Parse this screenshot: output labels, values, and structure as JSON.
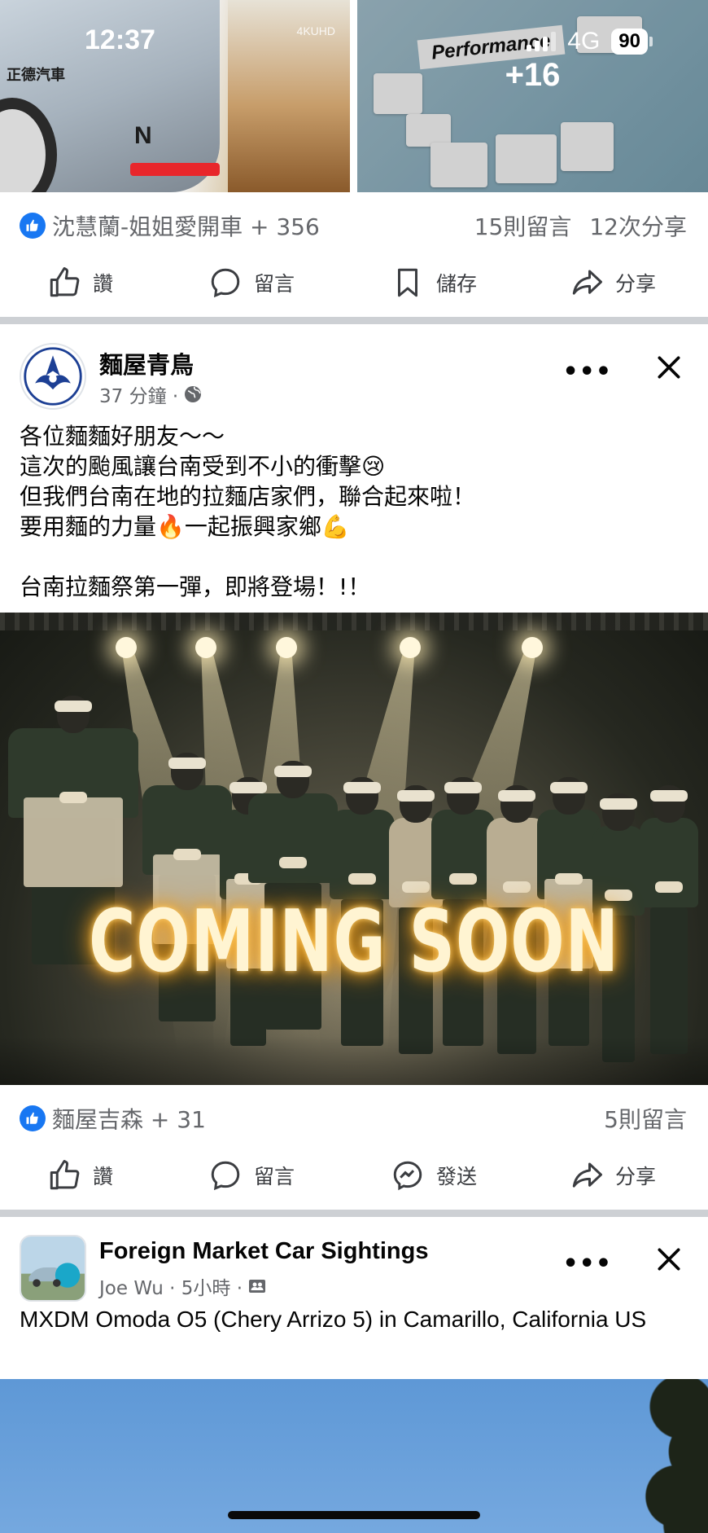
{
  "status_bar": {
    "time": "12:37",
    "network": "4G",
    "battery": "90"
  },
  "post1": {
    "photos": {
      "left_dealer": "正德汽車",
      "left_badge": "N",
      "left_sign": "4KUHD",
      "right_sticker": "Performance",
      "more_count": "+16"
    },
    "reactions": {
      "names": "沈慧蘭-姐姐愛開車 + 356",
      "comments": "15則留言",
      "shares": "12次分享"
    },
    "actions": {
      "like": "讚",
      "comment": "留言",
      "save": "儲存",
      "share": "分享"
    }
  },
  "post2": {
    "author": "麵屋青鳥",
    "time": "37 分鐘 ·",
    "text_lines": [
      "各位麵麵好朋友～～",
      "這次的颱風讓台南受到不小的衝擊😢",
      "但我們台南在地的拉麵店家們，聯合起來啦！",
      "要用麵的力量🔥一起振興家鄉💪",
      "",
      "台南拉麵祭第一彈，即將登場！!！"
    ],
    "image_text": "COMING SOON",
    "reactions": {
      "names": "麵屋吉森 + 31",
      "comments": "5則留言"
    },
    "actions": {
      "like": "讚",
      "comment": "留言",
      "send": "發送",
      "share": "分享"
    }
  },
  "post3": {
    "author": "Foreign Market Car Sightings",
    "meta": "Joe Wu · 5小時 ·",
    "text": "MXDM Omoda O5 (Chery Arrizo 5) in Camarillo, California US"
  },
  "colors": {
    "brand_blue": "#1877f2",
    "divider": "#cdd0d4",
    "secondary_text": "#65676b"
  }
}
